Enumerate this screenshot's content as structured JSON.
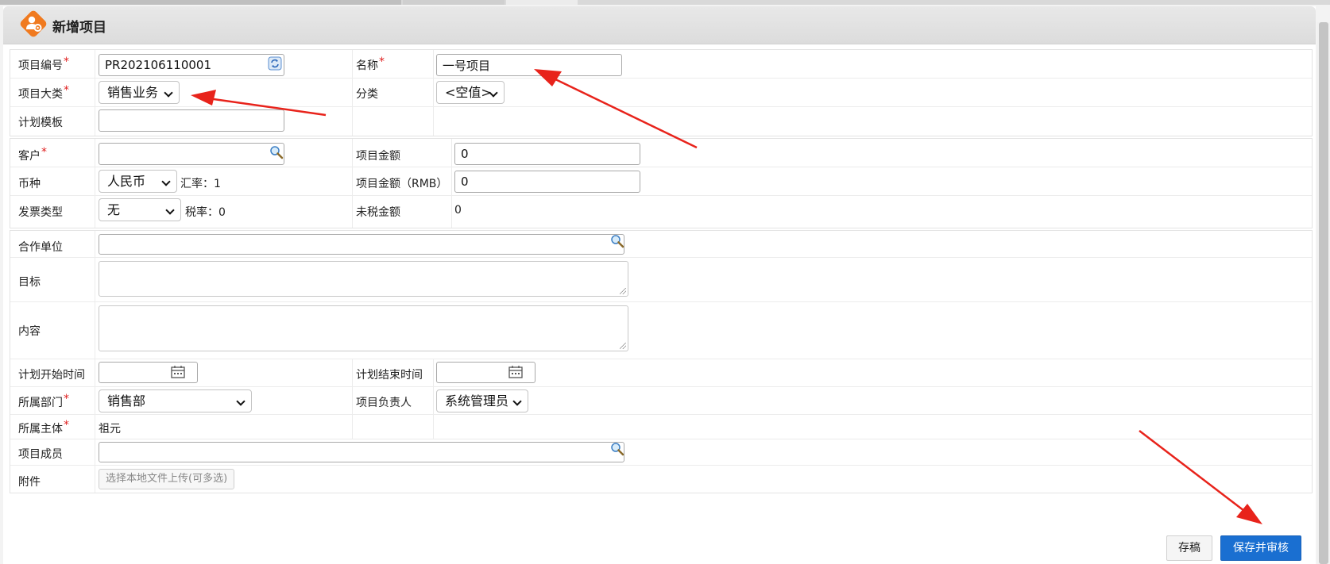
{
  "dialog": {
    "title": "新增项目"
  },
  "section1": {
    "project_no": {
      "label": "项目编号",
      "value": "PR202106110001"
    },
    "name": {
      "label": "名称",
      "value": "一号项目"
    },
    "category_major": {
      "label": "项目大类",
      "selected": "销售业务"
    },
    "category": {
      "label": "分类",
      "selected": "<空值>"
    },
    "plan_template": {
      "label": "计划模板",
      "value": ""
    }
  },
  "section2": {
    "customer": {
      "label": "客户",
      "value": ""
    },
    "amount": {
      "label": "项目金额",
      "value": "0"
    },
    "currency": {
      "label": "币种",
      "selected": "人民币",
      "rate_text": "汇率：1"
    },
    "amount_rmb": {
      "label": "项目金额（RMB）",
      "value": "0"
    },
    "invoice_type": {
      "label": "发票类型",
      "selected": "无",
      "tax_text": "税率：0"
    },
    "untaxed": {
      "label": "未税金额",
      "value": "0"
    }
  },
  "section3": {
    "partner": {
      "label": "合作单位",
      "value": ""
    },
    "goal": {
      "label": "目标"
    },
    "content": {
      "label": "内容"
    },
    "plan_start": {
      "label": "计划开始时间",
      "value": ""
    },
    "plan_end": {
      "label": "计划结束时间",
      "value": ""
    },
    "department": {
      "label": "所属部门",
      "selected": "销售部"
    },
    "owner": {
      "label": "项目负责人",
      "selected": "系统管理员"
    },
    "entity": {
      "label": "所属主体",
      "value": "祖元"
    },
    "members": {
      "label": "项目成员",
      "value": ""
    },
    "attachment": {
      "label": "附件",
      "upload_label": "选择本地文件上传(可多选)"
    }
  },
  "footer": {
    "draft_label": "存稿",
    "save_label": "保存并审核"
  },
  "colors": {
    "accent": "#1a6fd1",
    "required": "#e02020",
    "logo": "#f07a1f",
    "arrow": "#e8231b"
  }
}
